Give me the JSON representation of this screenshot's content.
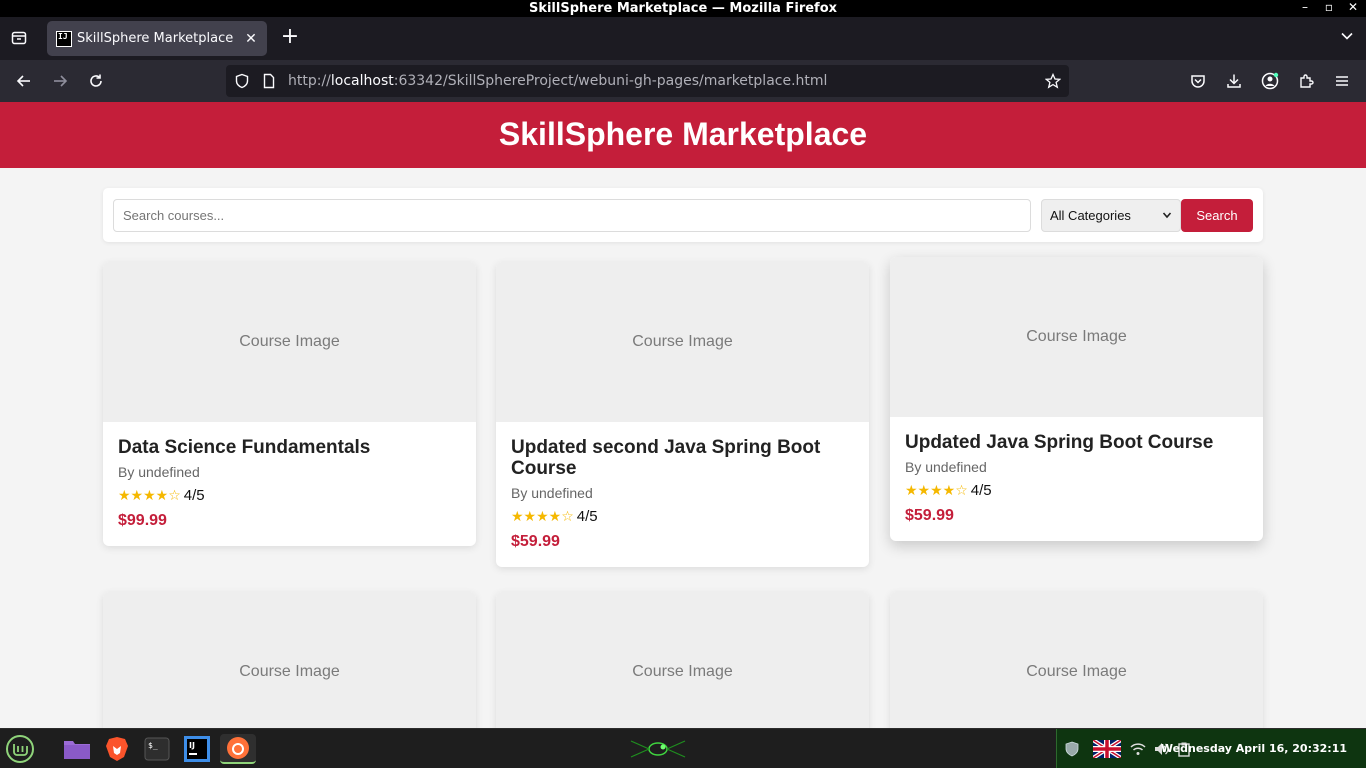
{
  "window": {
    "title": "SkillSphere Marketplace — Mozilla Firefox"
  },
  "browser": {
    "tab_title": "SkillSphere Marketplace",
    "favicon_text": "IJ",
    "url_prefix": "http://",
    "url_host": "localhost",
    "url_rest": ":63342/SkillSphereProject/webuni-gh-pages/marketplace.html"
  },
  "page": {
    "header_title": "SkillSphere Marketplace",
    "search_placeholder": "Search courses...",
    "category_selected": "All Categories",
    "search_button": "Search",
    "accent_color": "#c41e3a",
    "star_color": "#f5b800",
    "courses": [
      {
        "image_label": "Course Image",
        "title": "Data Science Fundamentals",
        "author": "By undefined",
        "stars": "★★★★☆",
        "rating": "4/5",
        "price": "$99.99"
      },
      {
        "image_label": "Course Image",
        "title": "Updated second Java Spring Boot Course",
        "author": "By undefined",
        "stars": "★★★★☆",
        "rating": "4/5",
        "price": "$59.99"
      },
      {
        "image_label": "Course Image",
        "title": "Updated Java Spring Boot Course",
        "author": "By undefined",
        "stars": "★★★★☆",
        "rating": "4/5",
        "price": "$59.99"
      },
      {
        "image_label": "Course Image"
      },
      {
        "image_label": "Course Image"
      },
      {
        "image_label": "Course Image"
      }
    ]
  },
  "taskbar": {
    "clock": "Wednesday April 16, 20:32:11",
    "tray_color": "#0e3510"
  }
}
